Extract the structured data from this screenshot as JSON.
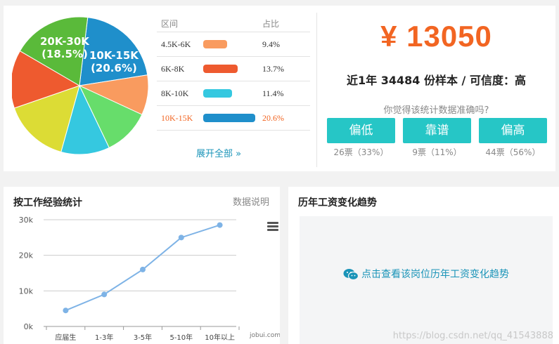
{
  "salary_distribution": {
    "columns": {
      "range": "区间",
      "ratio": "占比"
    },
    "rows": [
      {
        "range": "4.5K-6K",
        "ratio": "9.4%",
        "percent": 9.4,
        "color": "#f99b5f",
        "highlight": false
      },
      {
        "range": "6K-8K",
        "ratio": "13.7%",
        "percent": 13.7,
        "color": "#ee5a2f",
        "highlight": false
      },
      {
        "range": "8K-10K",
        "ratio": "11.4%",
        "percent": 11.4,
        "color": "#35c8e0",
        "highlight": false
      },
      {
        "range": "10K-15K",
        "ratio": "20.6%",
        "percent": 20.6,
        "color": "#1f8fcb",
        "highlight": true
      }
    ],
    "expand_label": "展开全部 »",
    "pie_labels": [
      {
        "range": "20K-30K",
        "ratio": "(18.5%)"
      },
      {
        "range": "10K-15K",
        "ratio": "(20.6%)"
      }
    ]
  },
  "pie": {
    "slices": [
      {
        "color": "#1f8fcb",
        "percent": 20.6
      },
      {
        "color": "#f99b5f",
        "percent": 9.4
      },
      {
        "color": "#67dd6b",
        "percent": 11
      },
      {
        "color": "#35c8e0",
        "percent": 11.4
      },
      {
        "color": "#dcdc35",
        "percent": 15.4
      },
      {
        "color": "#ee5a2f",
        "percent": 13.7
      },
      {
        "color": "#5aba3a",
        "percent": 18.5
      }
    ]
  },
  "summary": {
    "price": "¥ 13050",
    "sample_text": "近1年 34484 份样本 / 可信度：高",
    "question": "你觉得该统计数据准确吗?",
    "votes": [
      {
        "label": "偏低",
        "count": "26票（33%）"
      },
      {
        "label": "靠谱",
        "count": "9票（11%）"
      },
      {
        "label": "偏高",
        "count": "44票（56%）"
      }
    ]
  },
  "experience_card": {
    "title": "按工作经验统计",
    "data_note": "数据说明",
    "credit": "jobui.com"
  },
  "chart_data": {
    "type": "line",
    "categories": [
      "应届生",
      "1-3年",
      "3-5年",
      "5-10年",
      "10年以上"
    ],
    "values": [
      4500,
      9000,
      16000,
      25000,
      28500
    ],
    "y_ticks": [
      "0k",
      "10k",
      "20k",
      "30k"
    ],
    "ylim": [
      0,
      30000
    ],
    "grid": true,
    "color": "#7eb3e6"
  },
  "trend_card": {
    "title": "历年工资变化趋势",
    "link_text": "点击查看该岗位历年工资变化趋势"
  },
  "watermark": "https://blog.csdn.net/qq_41543888"
}
